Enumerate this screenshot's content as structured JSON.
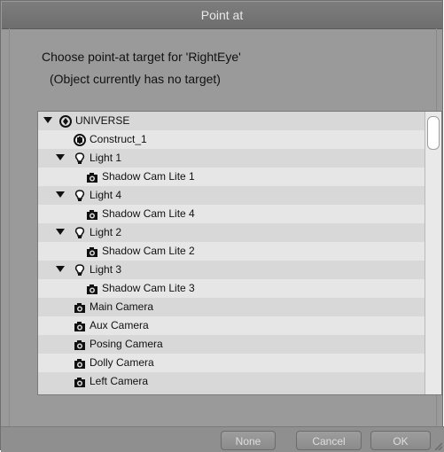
{
  "dialog": {
    "title": "Point at",
    "prompt": "Choose point-at target for 'RightEye'",
    "subprompt": "(Object currently has no target)"
  },
  "tree": [
    {
      "label": "UNIVERSE",
      "icon": "globe-icon",
      "expanded": true
    },
    {
      "label": "Construct_1",
      "icon": "construct-icon",
      "expanded": false
    },
    {
      "label": "Light 1",
      "icon": "light-bulb-icon",
      "expanded": true
    },
    {
      "label": "Shadow Cam Lite 1",
      "icon": "camera-icon",
      "expanded": false
    },
    {
      "label": "Light 4",
      "icon": "light-bulb-icon",
      "expanded": true
    },
    {
      "label": "Shadow Cam Lite 4",
      "icon": "camera-icon",
      "expanded": false
    },
    {
      "label": "Light 2",
      "icon": "light-bulb-icon",
      "expanded": true
    },
    {
      "label": "Shadow Cam Lite 2",
      "icon": "camera-icon",
      "expanded": false
    },
    {
      "label": "Light 3",
      "icon": "light-bulb-icon",
      "expanded": true
    },
    {
      "label": "Shadow Cam Lite 3",
      "icon": "camera-icon",
      "expanded": false
    },
    {
      "label": "Main Camera",
      "icon": "camera-icon",
      "expanded": false
    },
    {
      "label": "Aux Camera",
      "icon": "camera-icon",
      "expanded": false
    },
    {
      "label": "Posing Camera",
      "icon": "camera-icon",
      "expanded": false
    },
    {
      "label": "Dolly Camera",
      "icon": "camera-icon",
      "expanded": false
    },
    {
      "label": "Left Camera",
      "icon": "camera-icon",
      "expanded": false
    }
  ],
  "buttons": {
    "none": "None",
    "cancel": "Cancel",
    "ok": "OK"
  }
}
